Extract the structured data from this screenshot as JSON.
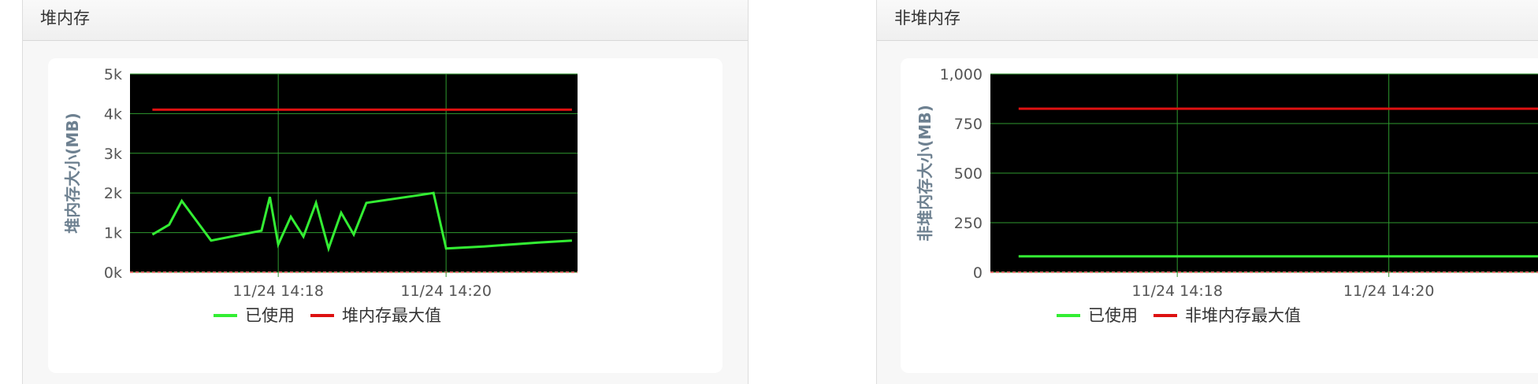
{
  "panels": [
    {
      "title": "堆内存",
      "chart_data": {
        "type": "line",
        "ylabel": "堆内存大小(MB)",
        "ylim": [
          0,
          5000
        ],
        "y_ticks": [
          0,
          1000,
          2000,
          3000,
          4000,
          5000
        ],
        "y_tick_labels": [
          "0k",
          "1k",
          "2k",
          "3k",
          "4k",
          "5k"
        ],
        "xlim": [
          "11/24 14:16:14",
          "11/24 14:21:34"
        ],
        "x_ticks": [
          "11/24 14:18",
          "11/24 14:20"
        ],
        "series": [
          {
            "name": "已使用",
            "color": "#33ee33",
            "points": [
              [
                "11/24 14:16:30",
                950
              ],
              [
                "11/24 14:16:42",
                1200
              ],
              [
                "11/24 14:16:51",
                1800
              ],
              [
                "11/24 14:17:12",
                800
              ],
              [
                "11/24 14:17:48",
                1050
              ],
              [
                "11/24 14:17:54",
                1900
              ],
              [
                "11/24 14:18:00",
                700
              ],
              [
                "11/24 14:18:09",
                1400
              ],
              [
                "11/24 14:18:18",
                900
              ],
              [
                "11/24 14:18:27",
                1750
              ],
              [
                "11/24 14:18:36",
                600
              ],
              [
                "11/24 14:18:45",
                1500
              ],
              [
                "11/24 14:18:54",
                950
              ],
              [
                "11/24 14:19:03",
                1750
              ],
              [
                "11/24 14:19:42",
                1950
              ],
              [
                "11/24 14:19:51",
                2000
              ],
              [
                "11/24 14:20:00",
                600
              ],
              [
                "11/24 14:20:27",
                650
              ],
              [
                "11/24 14:21:06",
                750
              ],
              [
                "11/24 14:21:30",
                800
              ]
            ]
          },
          {
            "name": "堆内存最大值",
            "color": "#dd1111",
            "points": [
              [
                "11/24 14:16:30",
                4100
              ],
              [
                "11/24 14:21:30",
                4100
              ]
            ]
          }
        ]
      }
    },
    {
      "title": "非堆内存",
      "chart_data": {
        "type": "line",
        "ylabel": "非堆内存大小(MB)",
        "ylim": [
          0,
          1000
        ],
        "y_ticks": [
          0,
          250,
          500,
          750,
          1000
        ],
        "y_tick_labels": [
          "0",
          "250",
          "500",
          "750",
          "1,000"
        ],
        "xlim": [
          "11/24 14:16:14",
          "11/24 14:21:34"
        ],
        "x_ticks": [
          "11/24 14:18",
          "11/24 14:20"
        ],
        "series": [
          {
            "name": "已使用",
            "color": "#33ee33",
            "points": [
              [
                "11/24 14:16:30",
                80
              ],
              [
                "11/24 14:21:30",
                80
              ]
            ]
          },
          {
            "name": "非堆内存最大值",
            "color": "#dd1111",
            "points": [
              [
                "11/24 14:16:30",
                825
              ],
              [
                "11/24 14:21:30",
                825
              ]
            ]
          }
        ]
      }
    }
  ]
}
